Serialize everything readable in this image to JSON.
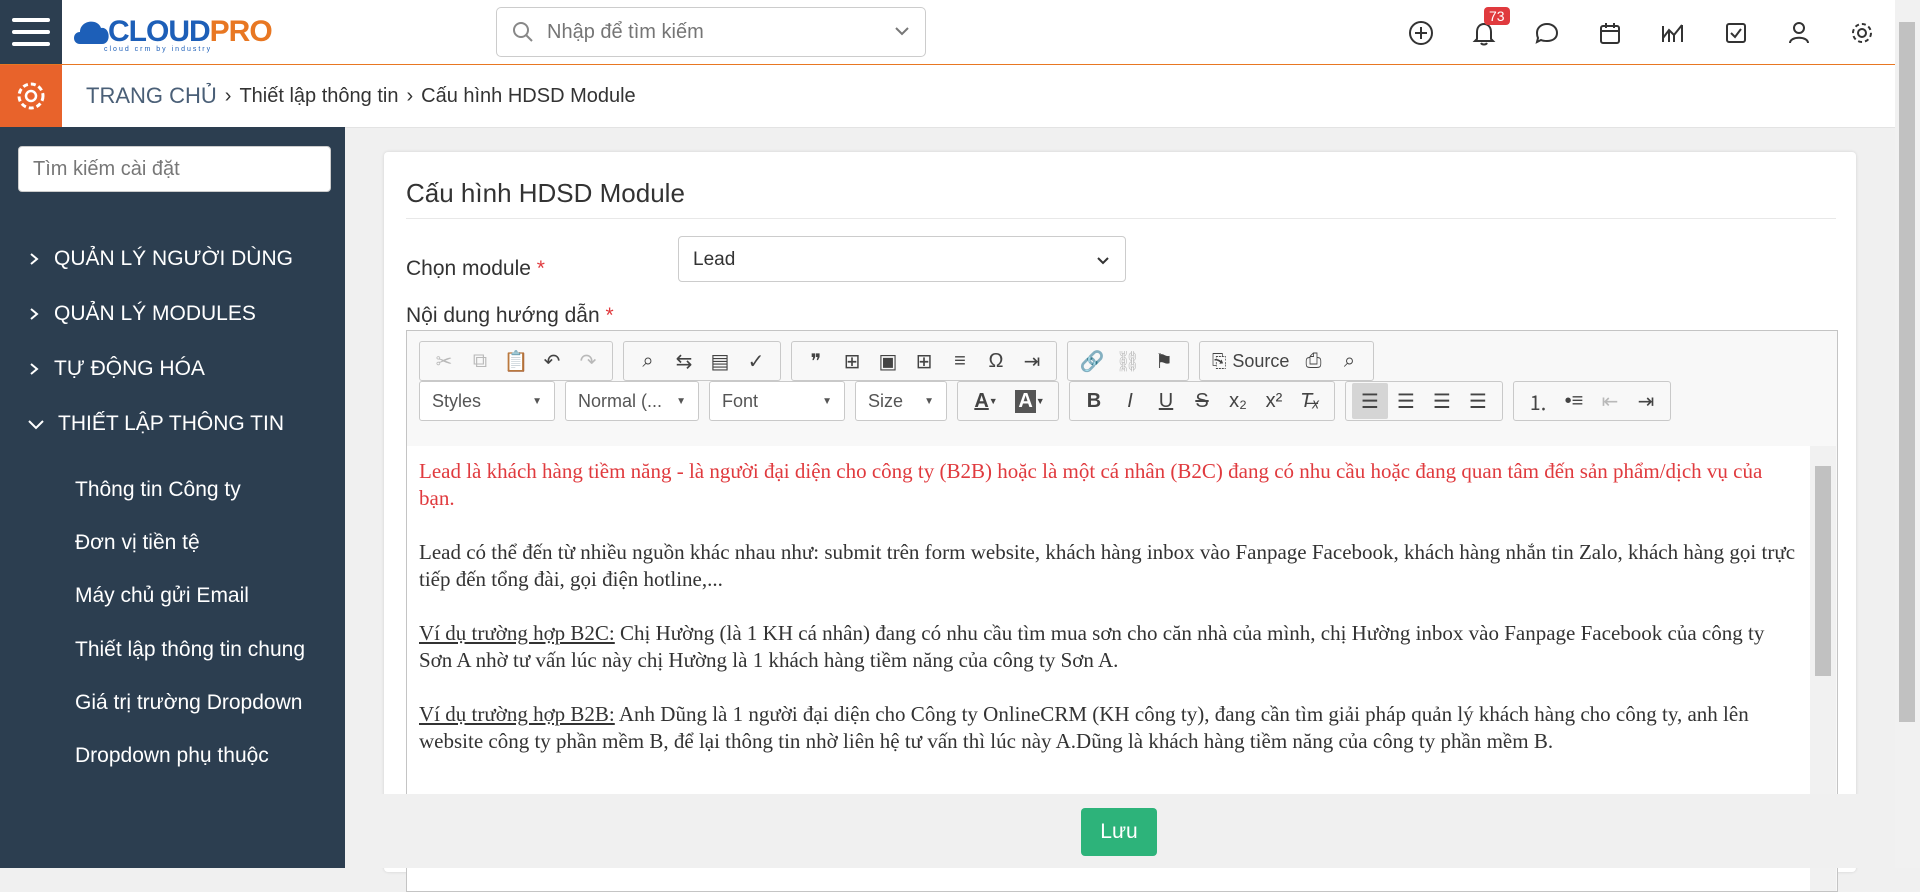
{
  "header": {
    "logo_text_a": "CLOUD",
    "logo_text_b": "PRO",
    "logo_tagline": "cloud crm by industry",
    "search_placeholder": "Nhập để tìm kiếm",
    "notification_count": "73"
  },
  "breadcrumb": {
    "home": "TRANG CHỦ",
    "level1": "Thiết lập thông tin",
    "level2": "Cấu hình HDSD Module"
  },
  "sidebar": {
    "search_placeholder": "Tìm kiếm cài đặt",
    "sections": [
      {
        "label": "QUẢN LÝ NGƯỜI DÙNG"
      },
      {
        "label": "QUẢN LÝ MODULES"
      },
      {
        "label": "TỰ ĐỘNG HÓA"
      },
      {
        "label": "THIẾT LẬP THÔNG TIN"
      }
    ],
    "sub_items": [
      {
        "label": "Thông tin Công ty"
      },
      {
        "label": "Đơn vị tiền tệ"
      },
      {
        "label": "Máy chủ gửi Email"
      },
      {
        "label": "Thiết lập thông tin chung"
      },
      {
        "label": "Giá trị trường Dropdown"
      },
      {
        "label": "Dropdown phụ thuộc"
      }
    ]
  },
  "form": {
    "title": "Cấu hình HDSD Module",
    "module_label": "Chọn module",
    "module_value": "Lead",
    "content_label": "Nội dung hướng dẫn",
    "required_mark": "*"
  },
  "toolbar": {
    "source_label": "Source",
    "styles": "Styles",
    "format": "Normal (...",
    "font": "Font",
    "size": "Size"
  },
  "content": {
    "p1": "Lead là khách hàng tiềm năng - là người đại diện cho công ty (B2B) hoặc là một cá nhân (B2C) đang có nhu cầu hoặc đang quan tâm đến sản phẩm/dịch vụ của bạn.",
    "p2": "Lead có thể đến từ nhiều nguồn khác nhau như: submit trên form website, khách hàng inbox vào Fanpage Facebook, khách hàng nhắn tin Zalo, khách hàng gọi trực tiếp đến tổng đài, gọi điện hotline,...",
    "p3_head": "Ví dụ trường hợp B2C:",
    "p3_body": "  Chị Hường (là 1 KH cá nhân) đang có nhu cầu tìm mua sơn cho căn nhà của mình, chị Hường inbox vào Fanpage Facebook của công ty Sơn A nhờ tư vấn lúc này chị Hường là 1 khách hàng tiềm năng của công ty Sơn A.",
    "p4_head": "Ví dụ trường hợp B2B:",
    "p4_body": " Anh Dũng là 1 người đại diện cho Công ty OnlineCRM (KH công ty), đang cần tìm giải pháp quản lý khách hàng cho công ty, anh lên website công ty phần mềm B, để lại thông tin nhờ liên hệ tư vấn thì lúc này A.Dũng là khách hàng tiềm năng của công ty phần mềm B."
  },
  "actions": {
    "save_label": "Lưu"
  }
}
